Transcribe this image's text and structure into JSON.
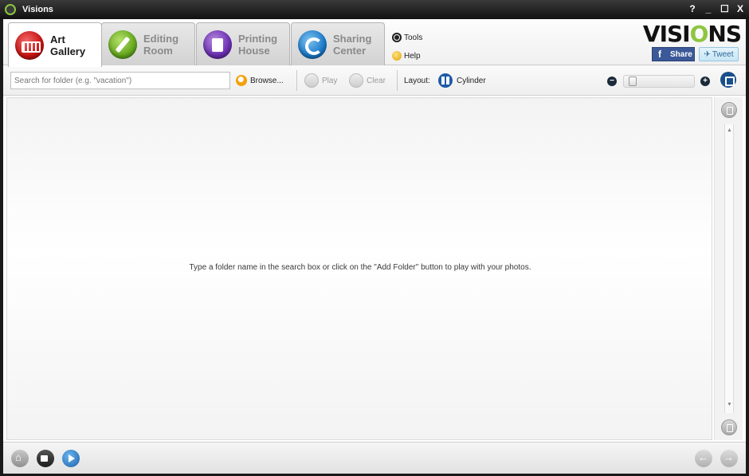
{
  "window": {
    "title": "Visions",
    "controls": {
      "help": "?",
      "minimize": "_",
      "maximize": "☐",
      "close": "X"
    }
  },
  "tabs": [
    {
      "line1": "Art",
      "line2": "Gallery",
      "icon": "art-gallery-icon",
      "active": true
    },
    {
      "line1": "Editing",
      "line2": "Room",
      "icon": "editing-room-icon",
      "active": false
    },
    {
      "line1": "Printing",
      "line2": "House",
      "icon": "printing-house-icon",
      "active": false
    },
    {
      "line1": "Sharing",
      "line2": "Center",
      "icon": "sharing-center-icon",
      "active": false
    }
  ],
  "menus": {
    "tools": "Tools",
    "help": "Help"
  },
  "brand": {
    "logo_pre": "VISI",
    "logo_o": "O",
    "logo_post": "NS",
    "share": "Share",
    "tweet": "Tweet",
    "accent": "#8dc63f"
  },
  "toolbar": {
    "search_placeholder": "Search for folder (e.g. \"vacation\")",
    "browse": "Browse...",
    "play": "Play",
    "clear": "Clear",
    "layout_label": "Layout:",
    "layout_value": "Cylinder",
    "zoom_level": 0.05
  },
  "main": {
    "empty_hint": "Type a folder name in the search box or click on the \"Add Folder\" button to play with your photos."
  },
  "colors": {
    "art": "#c91212",
    "edit": "#66a81e",
    "print": "#6c2fb3",
    "share": "#1c7ac8",
    "facebook": "#3b5998"
  }
}
